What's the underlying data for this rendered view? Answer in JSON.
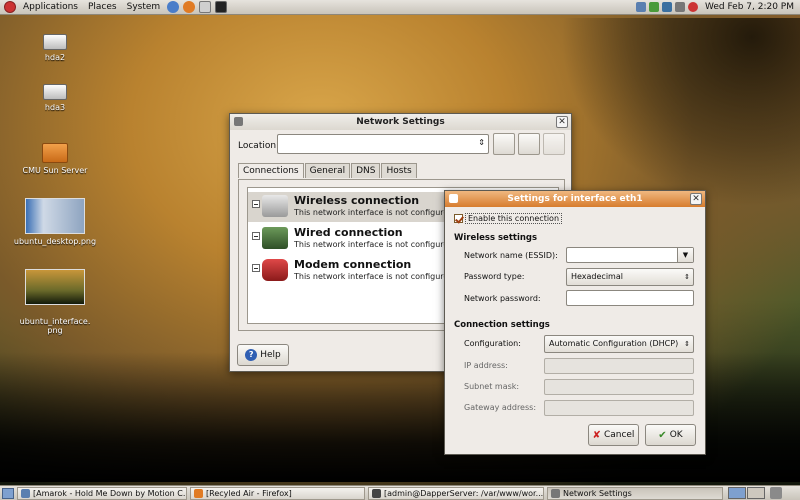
{
  "top_panel": {
    "menus": [
      "Applications",
      "Places",
      "System"
    ],
    "clock": "Wed Feb  7,  2:20 PM"
  },
  "desktop_icons": [
    "hda2",
    "hda3",
    "CMU Sun Server",
    "ubuntu_desktop.png",
    "ubuntu_interface.\npng"
  ],
  "network_settings": {
    "title": "Network Settings",
    "location_label": "Location:",
    "location_value": "",
    "tabs": [
      "Connections",
      "General",
      "DNS",
      "Hosts"
    ],
    "connections": [
      {
        "name": "Wireless connection",
        "status": "This network interface is not configured"
      },
      {
        "name": "Wired connection",
        "status": "This network interface is not configured"
      },
      {
        "name": "Modem connection",
        "status": "This network interface is not configured"
      }
    ],
    "help_label": "Help"
  },
  "interface_settings": {
    "title": "Settings for interface eth1",
    "enable_label": "Enable this connection",
    "wireless_heading": "Wireless settings",
    "essid_label": "Network name (ESSID):",
    "essid_value": "",
    "password_type_label": "Password type:",
    "password_type_value": "Hexadecimal",
    "password_label": "Network password:",
    "password_value": "",
    "connection_heading": "Connection settings",
    "configuration_label": "Configuration:",
    "configuration_value": "Automatic Configuration (DHCP)",
    "ip_label": "IP address:",
    "subnet_label": "Subnet mask:",
    "gateway_label": "Gateway address:",
    "cancel_label": "Cancel",
    "ok_label": "OK"
  },
  "taskbar": {
    "tasks": [
      "[Amarok - Hold Me Down by Motion C...",
      "[Recyled Air - Firefox]",
      "[admin@DapperServer: /var/www/wor...",
      "Network Settings"
    ]
  }
}
